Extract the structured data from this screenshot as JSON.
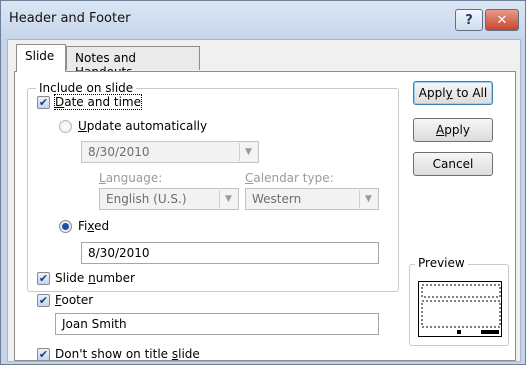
{
  "window": {
    "title": "Header and Footer",
    "help_glyph": "?",
    "close_glyph": "✕"
  },
  "tabs": [
    {
      "label": "Slide",
      "selected": true
    },
    {
      "label": "Notes and Handouts",
      "selected": false
    }
  ],
  "include_group": {
    "label": "Include on slide",
    "date_time": {
      "prefix": "",
      "mnemonic": "D",
      "rest": "ate and time",
      "checked": true
    },
    "update_auto": {
      "mnemonic": "U",
      "rest": "pdate automatically",
      "selected": false
    },
    "date_combo_value": "8/30/2010",
    "language": {
      "mnemonic": "L",
      "rest": "anguage:",
      "value": "English (U.S.)"
    },
    "calendar": {
      "mnemonic": "C",
      "rest": "alendar type:",
      "value": "Western"
    },
    "fixed": {
      "pre": "Fi",
      "mnemonic": "x",
      "rest": "ed",
      "selected": true,
      "value": "8/30/2010"
    },
    "slide_number": {
      "pre": "Slide ",
      "mnemonic": "n",
      "rest": "umber",
      "checked": true
    },
    "footer": {
      "mnemonic": "F",
      "rest": "ooter",
      "checked": true,
      "value": "Joan Smith"
    }
  },
  "dont_show": {
    "pre": "Don't show on title ",
    "mnemonic": "s",
    "rest": "lide",
    "checked": true
  },
  "buttons": {
    "apply_all": {
      "pre": "Appl",
      "mnemonic": "y",
      "rest": " to All"
    },
    "apply": {
      "mnemonic": "A",
      "rest": "pply"
    },
    "cancel": "Cancel"
  },
  "preview": {
    "label": "Preview"
  }
}
